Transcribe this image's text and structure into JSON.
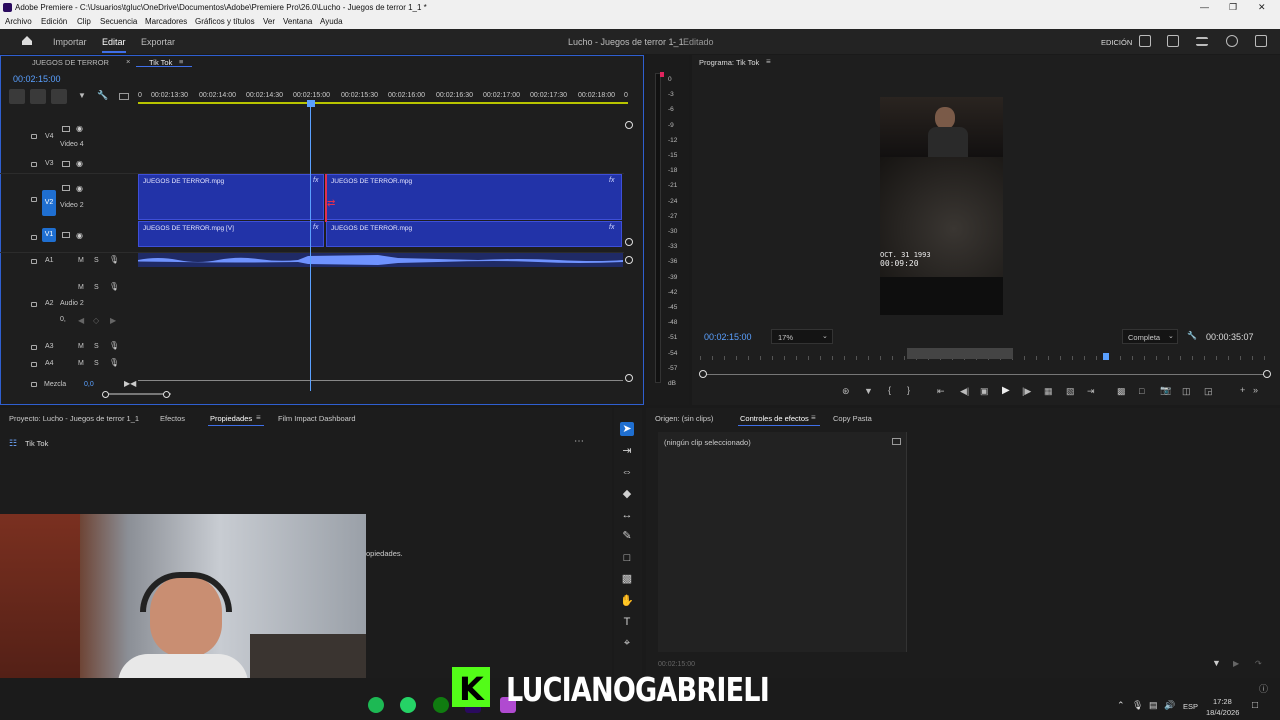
{
  "window": {
    "title": "Adobe Premiere - C:\\Usuarios\\tgluc\\OneDrive\\Documentos\\Adobe\\Premiere Pro\\26.0\\Lucho - Juegos de terror 1_1 *"
  },
  "menu": [
    "Archivo",
    "Edición",
    "Clip",
    "Secuencia",
    "Marcadores",
    "Gráficos y títulos",
    "Ver",
    "Ventana",
    "Ayuda"
  ],
  "header": {
    "tabs": [
      "Importar",
      "Editar",
      "Exportar"
    ],
    "project_title": "Lucho - Juegos de terror 1_1",
    "status": "Editado",
    "workspace": "EDICIÓN"
  },
  "timeline": {
    "tabs": [
      "JUEGOS DE TERROR",
      "Tik Tok"
    ],
    "timecode": "00:02:15:00",
    "ruler": [
      "0",
      "00:02:13:30",
      "00:02:14:00",
      "00:02:14:30",
      "00:02:15:00",
      "00:02:15:30",
      "00:02:16:00",
      "00:02:16:30",
      "00:02:17:00",
      "00:02:17:30",
      "00:02:18:00",
      "0"
    ],
    "tracks": {
      "v4": "V4",
      "v4_name": "Video 4",
      "v3": "V3",
      "v2": "V2",
      "v2_name": "Video 2",
      "v1": "V1",
      "a1": "A1",
      "a2": "A2",
      "a2_name": "Audio 2",
      "a3": "A3",
      "a4": "A4",
      "mix": "Mezcla",
      "mix_val": "0,0",
      "vol_val": "0,"
    },
    "clips": {
      "v2a": "JUEGOS DE TERROR.mpg",
      "v2b": "JUEGOS DE TERROR.mpg",
      "v1a": "JUEGOS DE TERROR.mpg [V]",
      "v1b": "JUEGOS DE TERROR.mpg"
    },
    "fx": "fx",
    "m": "M",
    "s": "S"
  },
  "meter": [
    "0",
    "-3",
    "-6",
    "-9",
    "-12",
    "-15",
    "-18",
    "-21",
    "-24",
    "-27",
    "-30",
    "-33",
    "-36",
    "-39",
    "-42",
    "-45",
    "-48",
    "-51",
    "-54",
    "-57",
    "dB"
  ],
  "program": {
    "title": "Programa: Tik Tok",
    "timecode": "00:02:15:00",
    "zoom": "17%",
    "quality": "Completa",
    "duration": "00:00:35:07",
    "overlay_date": "OCT. 31 1993",
    "overlay_time": "00:09:20"
  },
  "project_panel": {
    "tabs": [
      "Proyecto: Lucho - Juegos de terror 1_1",
      "Efectos",
      "Propiedades",
      "Film Impact Dashboard"
    ],
    "item": "Tik Tok",
    "hint": "opiedades."
  },
  "effects_panel": {
    "tabs": [
      "Origen: (sin clips)",
      "Controles de efectos",
      "Copy Pasta"
    ],
    "none": "(ningún clip seleccionado)",
    "timecode": "00:02:15:00"
  },
  "banner": {
    "text": "LUCIANOGABRIELI"
  },
  "taskbar": {
    "lang": "ESP",
    "time": "17:28",
    "date": "18/4/2026"
  },
  "colors": {
    "accent": "#3f6fe8",
    "clip": "#2233a8",
    "brand_green": "#53fc18"
  }
}
